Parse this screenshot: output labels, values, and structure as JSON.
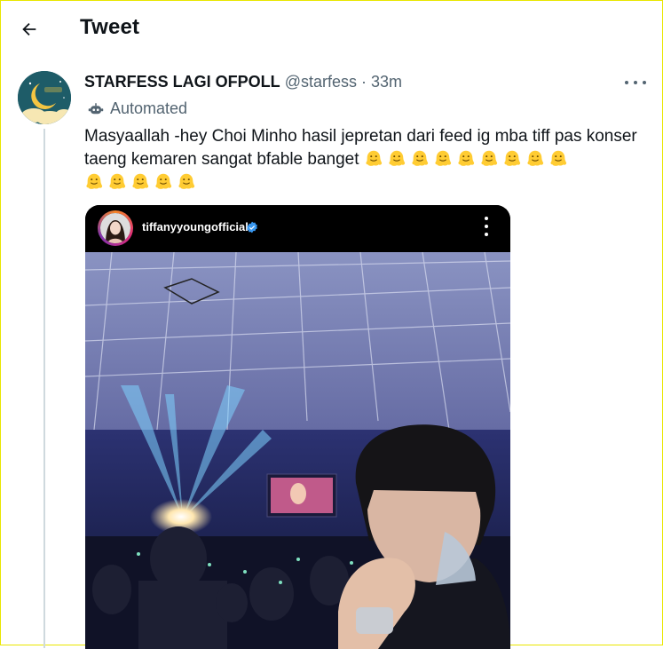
{
  "header": {
    "back_icon": "arrow-left-icon",
    "title": "Tweet"
  },
  "tweet": {
    "display_name": "STARFESS LAGI OFPOLL",
    "handle": "@starfess",
    "separator": "·",
    "time": "33m",
    "automated_label": "Automated",
    "text": "Masyaallah -hey Choi Minho hasil jepretan dari feed ig mba tiff pas konser taeng kemaren sangat bfable banget",
    "emoji_name": "melting-face-emoji",
    "emoji_count_line1": 9,
    "emoji_count_line2": 5
  },
  "media": {
    "instagram_username": "tiffanyyoungofficial",
    "verified": true
  },
  "colors": {
    "text_primary": "#0f1419",
    "text_secondary": "#536471",
    "frame_border": "#e9e600",
    "verified_blue": "#3897f0"
  }
}
